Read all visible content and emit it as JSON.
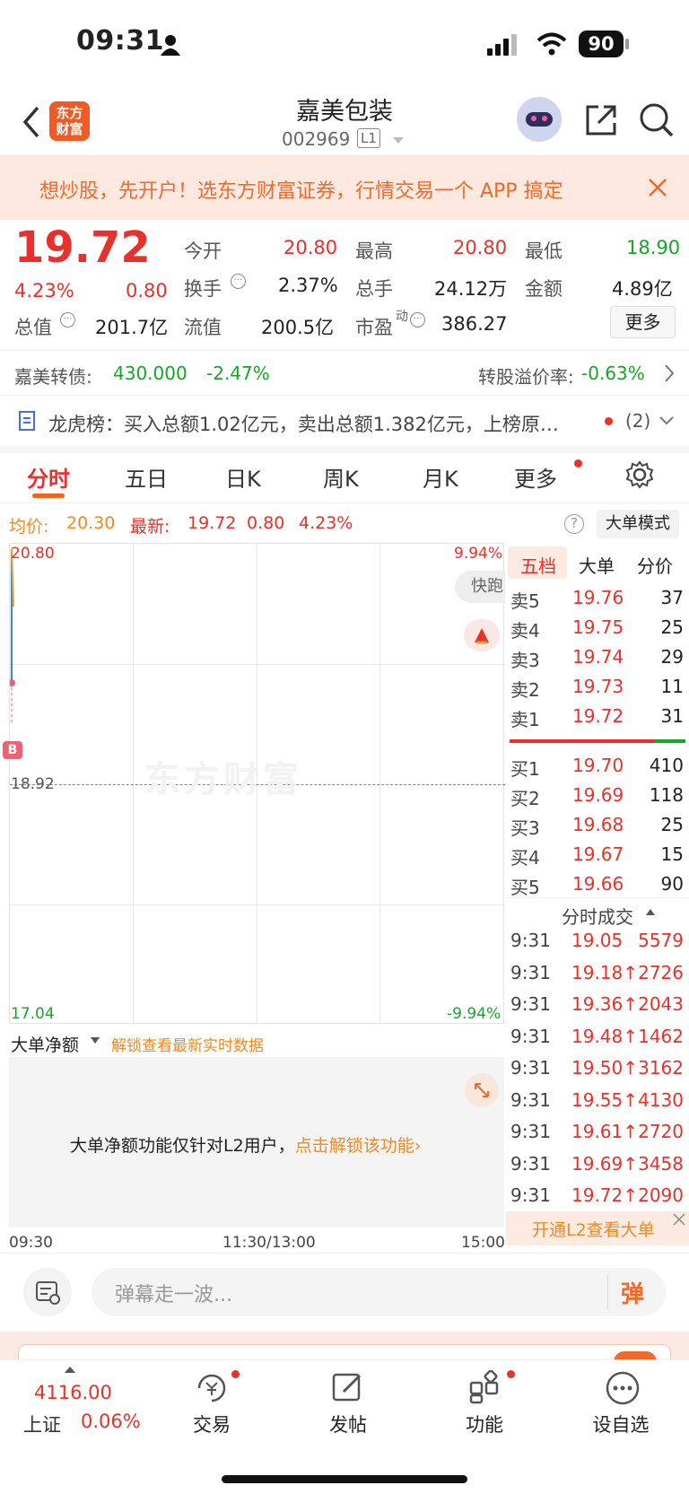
{
  "status": {
    "time": "09:31",
    "battery": "90"
  },
  "header": {
    "title": "嘉美包装",
    "code": "002969",
    "level": "L1",
    "logo_line1": "东方",
    "logo_line2": "财富"
  },
  "banner": {
    "text": "想炒股，先开户！选东方财富证券，行情交易一个 APP 搞定"
  },
  "quote": {
    "price": "19.72",
    "change_pct": "4.23%",
    "change": "0.80",
    "open_label": "今开",
    "open": "20.80",
    "high_label": "最高",
    "high": "20.80",
    "low_label": "最低",
    "low": "18.90",
    "turnover_label": "换手",
    "turnover": "2.37%",
    "volume_label": "总手",
    "volume": "24.12万",
    "amount_label": "金额",
    "amount": "4.89亿",
    "mcap_label": "总值",
    "mcap": "201.7亿",
    "float_label": "流值",
    "float": "200.5亿",
    "pe_label": "市盈",
    "pe_sup": "动",
    "pe": "386.27",
    "more": "更多"
  },
  "bond": {
    "label": "嘉美转债:",
    "price": "430.000",
    "pct": "-2.47%",
    "premium_label": "转股溢价率:",
    "premium": "-0.63%"
  },
  "lhb": {
    "text": "龙虎榜：买入总额1.02亿元，卖出总额1.382亿元，上榜原…",
    "count": "(2)"
  },
  "tabs": [
    "分时",
    "五日",
    "日K",
    "周K",
    "月K",
    "更多"
  ],
  "chart_head": {
    "avg_label": "均价:",
    "avg": "20.30",
    "last_label": "最新:",
    "last": "19.72",
    "chg": "0.80",
    "pct": "4.23%",
    "mode": "大单模式"
  },
  "chart": {
    "ymax": "20.80",
    "ymin": "17.04",
    "pmax": "9.94%",
    "pmin": "-9.94%",
    "ref": "18.92",
    "watermark": "东方财富",
    "quick": "快跑",
    "t1": "09:30",
    "t2": "11:30/13:00",
    "t3": "15:00",
    "b_marker": "B"
  },
  "net": {
    "label": "大单净额",
    "lock": "解锁查看最新实时数据",
    "msg": "大单净额功能仅针对L2用户，",
    "link": "点击解锁该功能"
  },
  "book": {
    "tabs": [
      "五档",
      "大单",
      "分价"
    ],
    "asks": [
      {
        "l": "卖5",
        "p": "19.76",
        "v": "37"
      },
      {
        "l": "卖4",
        "p": "19.75",
        "v": "25"
      },
      {
        "l": "卖3",
        "p": "19.74",
        "v": "29"
      },
      {
        "l": "卖2",
        "p": "19.73",
        "v": "11"
      },
      {
        "l": "卖1",
        "p": "19.72",
        "v": "31"
      }
    ],
    "bids": [
      {
        "l": "买1",
        "p": "19.70",
        "v": "410"
      },
      {
        "l": "买2",
        "p": "19.69",
        "v": "118"
      },
      {
        "l": "买3",
        "p": "19.68",
        "v": "25"
      },
      {
        "l": "买4",
        "p": "19.67",
        "v": "15"
      },
      {
        "l": "买5",
        "p": "19.66",
        "v": "90"
      }
    ],
    "ticks_title": "分时成交",
    "ticks": [
      {
        "t": "9:31",
        "p": "19.05",
        "v": "5579"
      },
      {
        "t": "9:31",
        "p": "19.18↑",
        "v": "2726"
      },
      {
        "t": "9:31",
        "p": "19.36↑",
        "v": "2043"
      },
      {
        "t": "9:31",
        "p": "19.48↑",
        "v": "1462"
      },
      {
        "t": "9:31",
        "p": "19.50↑",
        "v": "3162"
      },
      {
        "t": "9:31",
        "p": "19.55↑",
        "v": "4130"
      },
      {
        "t": "9:31",
        "p": "19.61↑",
        "v": "2720"
      },
      {
        "t": "9:31",
        "p": "19.69↑",
        "v": "3458"
      },
      {
        "t": "9:31",
        "p": "19.72↑",
        "v": "2090"
      }
    ],
    "l2": "开通L2查看大单"
  },
  "comment": {
    "placeholder": "弹幕走一波...",
    "btn": "弹"
  },
  "footer": {
    "index_value": "4116.00",
    "index_name": "上证",
    "index_pct": "0.06%",
    "items": [
      "交易",
      "发帖",
      "功能",
      "设自选"
    ]
  }
}
